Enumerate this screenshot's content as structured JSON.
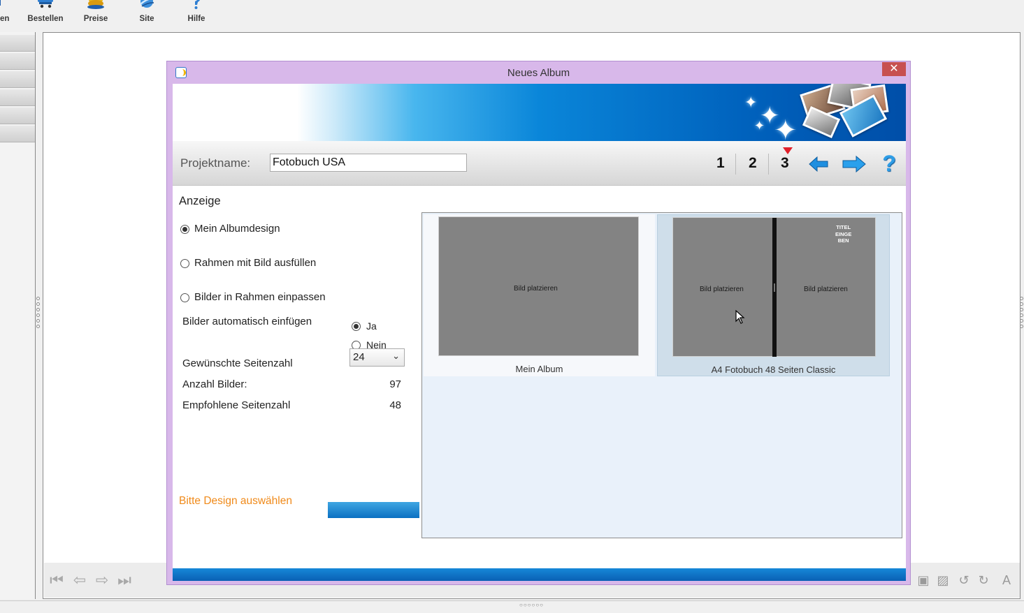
{
  "toolbar": {
    "items": [
      {
        "label": "en",
        "icon": "partial-icon"
      },
      {
        "label": "Bestellen",
        "icon": "cart-icon"
      },
      {
        "label": "Preise",
        "icon": "coins-icon"
      },
      {
        "label": "Site",
        "icon": "globe-icon"
      },
      {
        "label": "Hilfe",
        "icon": "info-icon"
      }
    ]
  },
  "dialog": {
    "title": "Neues Album",
    "close_label": "✕",
    "project": {
      "label": "Projektname:",
      "value": "Fotobuch USA"
    },
    "steps": [
      "1",
      "2",
      "3"
    ],
    "current_step": "3",
    "help_label": "?",
    "settings": {
      "heading": "Anzeige",
      "layout_options": [
        {
          "label": "Mein Albumdesign",
          "selected": true
        },
        {
          "label": "Rahmen mit Bild ausfüllen",
          "selected": false
        },
        {
          "label": "Bilder in Rahmen einpassen",
          "selected": false
        }
      ],
      "auto_insert": {
        "label": "Bilder automatisch einfügen",
        "options": [
          {
            "label": "Ja",
            "selected": true
          },
          {
            "label": "Nein",
            "selected": false
          }
        ]
      },
      "page_count": {
        "label": "Gewünschte Seitenzahl",
        "value": "24"
      },
      "image_count": {
        "label": "Anzahl Bilder:",
        "value": "97"
      },
      "recommended_pages": {
        "label": "Empfohlene Seitenzahl",
        "value": "48"
      },
      "hint": "Bitte Design auswählen"
    },
    "designs": [
      {
        "name": "Mein Album",
        "placeholder": "Bild platzieren",
        "selected": false
      },
      {
        "name": "A4 Fotobuch 48 Seiten Classic",
        "left_placeholder": "Bild platzieren",
        "right_placeholder": "Bild platzieren",
        "title_mark": [
          "TITEL",
          "EINGE",
          "BEN"
        ],
        "selected": true
      }
    ]
  },
  "colors": {
    "dialog_frame": "#d8b8ea",
    "accent_blue": "#0a70c2",
    "hint_orange": "#f08a1a",
    "close_red": "#c75050",
    "step_marker": "#e0202a"
  }
}
